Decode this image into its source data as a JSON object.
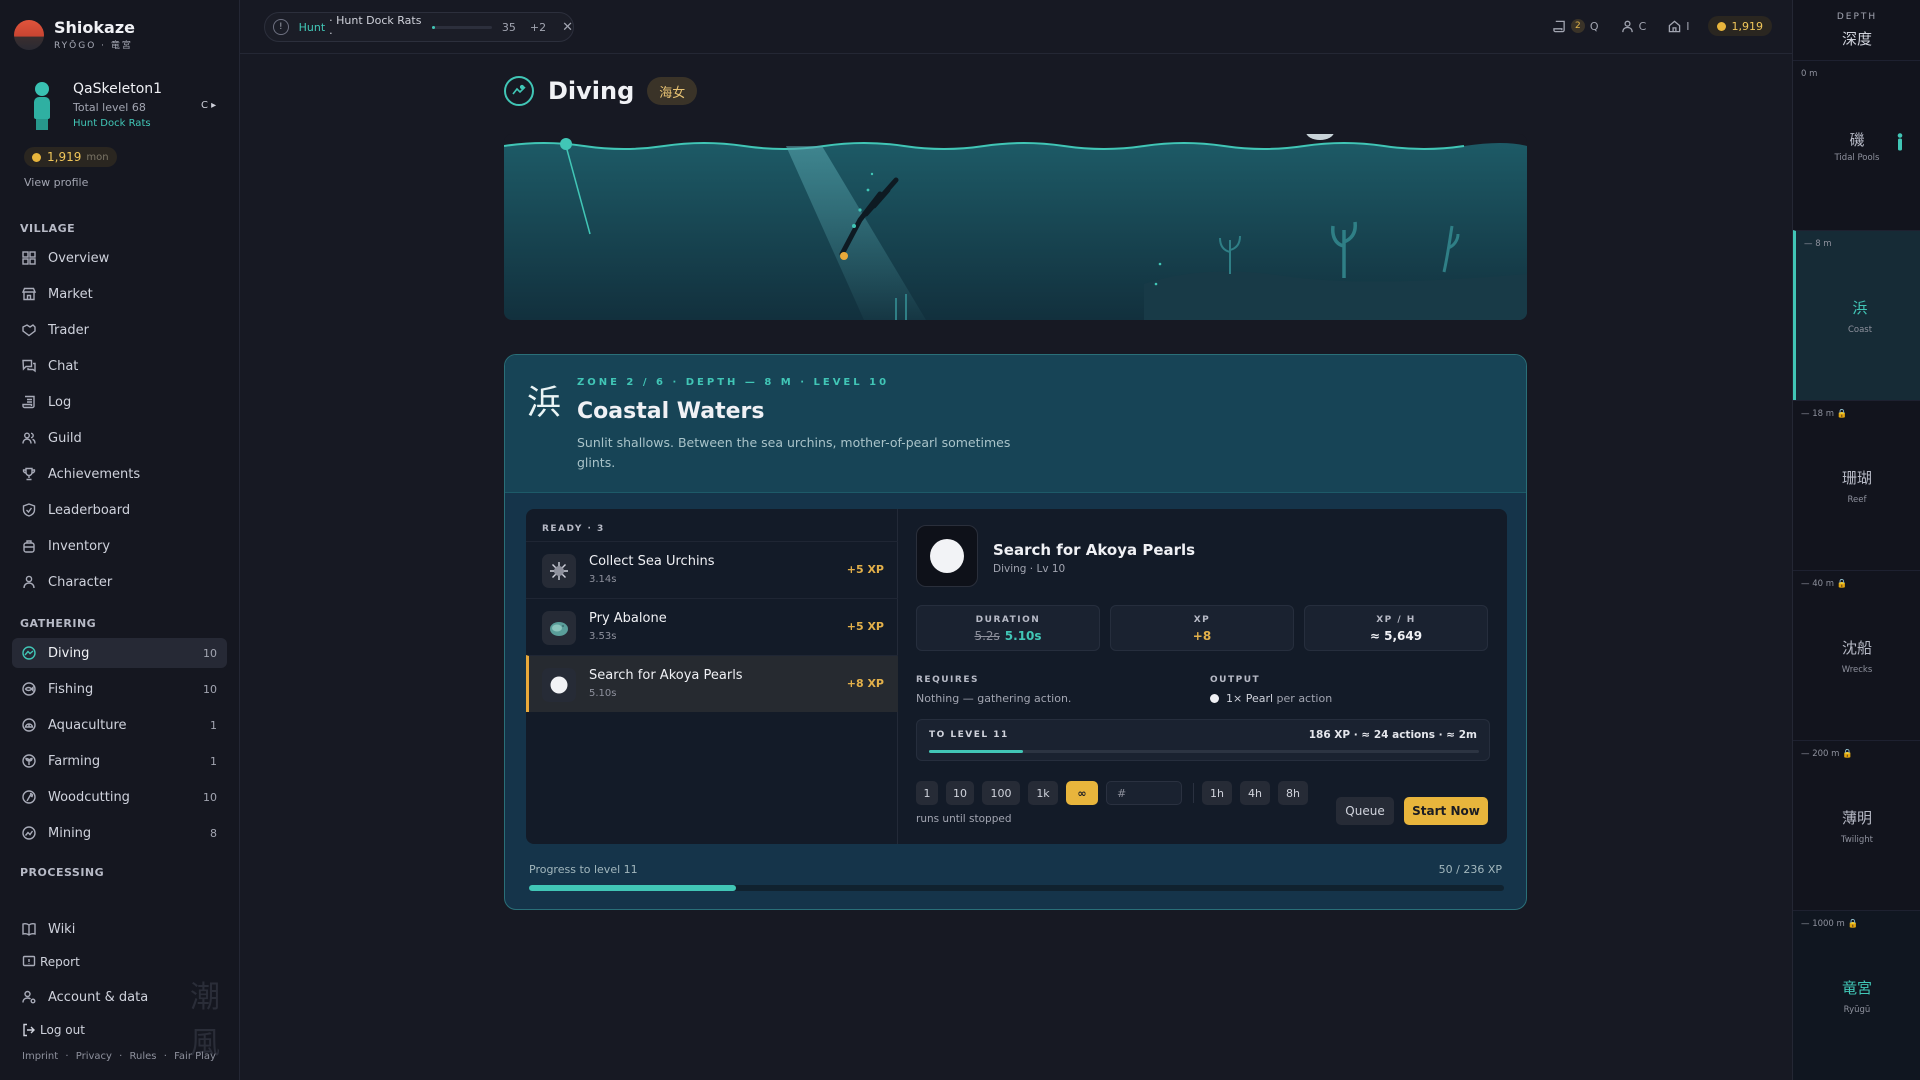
{
  "brand": {
    "name": "Shiokaze",
    "subtitle": "RYŌGO · 竜宮"
  },
  "profile": {
    "name": "QaSkeleton1",
    "level_text": "Total level 68",
    "task": "Hunt Dock Rats",
    "toggle": "C ▸",
    "coins": "1,919",
    "coin_unit": "mon",
    "view_profile": "View profile"
  },
  "sections": {
    "village": "VILLAGE",
    "gathering": "GATHERING",
    "processing": "PROCESSING"
  },
  "village_nav": [
    {
      "label": "Overview",
      "icon": "grid-icon"
    },
    {
      "label": "Market",
      "icon": "shop-icon"
    },
    {
      "label": "Trader",
      "icon": "handshake-icon"
    },
    {
      "label": "Chat",
      "icon": "chat-icon"
    },
    {
      "label": "Log",
      "icon": "scroll-icon"
    },
    {
      "label": "Guild",
      "icon": "users-icon"
    },
    {
      "label": "Achievements",
      "icon": "trophy-icon"
    },
    {
      "label": "Leaderboard",
      "icon": "shield-icon"
    },
    {
      "label": "Inventory",
      "icon": "backpack-icon"
    },
    {
      "label": "Character",
      "icon": "person-icon"
    }
  ],
  "gathering_nav": [
    {
      "label": "Diving",
      "badge": "10",
      "icon": "wave-icon",
      "active": true
    },
    {
      "label": "Fishing",
      "badge": "10",
      "icon": "fish-icon"
    },
    {
      "label": "Aquaculture",
      "badge": "1",
      "icon": "shell-icon"
    },
    {
      "label": "Farming",
      "badge": "1",
      "icon": "sprout-icon"
    },
    {
      "label": "Woodcutting",
      "badge": "10",
      "icon": "axe-icon"
    },
    {
      "label": "Mining",
      "badge": "8",
      "icon": "pickaxe-icon"
    }
  ],
  "bottom_nav": {
    "wiki": "Wiki",
    "report": "Report",
    "account": "Account & data",
    "logout": "Log out"
  },
  "watermark": "潮風",
  "footer": [
    "Imprint",
    "·",
    "Privacy",
    "·",
    "Rules",
    "·",
    "Fair Play"
  ],
  "topbar": {
    "task_kind": "Hunt",
    "task_name": "· Hunt Dock Rats ·",
    "task_progress": 0.05,
    "task_count": "35",
    "task_extra": "+2",
    "close": "✕",
    "mail_count": "2",
    "mail_label": "Q",
    "profile_label": "C",
    "house_label": "I",
    "coins": "1,919"
  },
  "page": {
    "title": "Diving",
    "tag": "海女"
  },
  "zone": {
    "kanji": "浜",
    "meta": "ZONE 2 / 6 · DEPTH — 8 M · LEVEL 10",
    "title": "Coastal Waters",
    "description": "Sunlit shallows. Between the sea urchins, mother-of-pearl sometimes glints."
  },
  "actions": {
    "ready_label": "READY · 3",
    "items": [
      {
        "name": "Collect Sea Urchins",
        "time": "3.14s",
        "xp": "+5 XP",
        "icon": "urchin-icon"
      },
      {
        "name": "Pry Abalone",
        "time": "3.53s",
        "xp": "+5 XP",
        "icon": "abalone-icon"
      },
      {
        "name": "Search for Akoya Pearls",
        "time": "5.10s",
        "xp": "+8 XP",
        "icon": "pearl-icon",
        "selected": true
      }
    ]
  },
  "detail": {
    "name": "Search for Akoya Pearls",
    "sub": "Diving · Lv 10",
    "duration_label": "DURATION",
    "duration_old": "5.2s",
    "duration_new": "5.10s",
    "xp_label": "XP",
    "xp_val": "+8",
    "xph_label": "XP / H",
    "xph_val": "≈ 5,649",
    "requires_label": "REQUIRES",
    "requires_text": "Nothing — gathering action.",
    "output_label": "OUTPUT",
    "output_qty": "1×",
    "output_item": "Pearl",
    "output_suffix": "per action",
    "level_label": "TO LEVEL 11",
    "level_info": "186 XP · ≈ 24 actions · ≈ 2m",
    "level_progress": 0.17,
    "qty_options": [
      "1",
      "10",
      "100",
      "1k",
      "∞"
    ],
    "qty_placeholder": "#",
    "time_options": [
      "1h",
      "4h",
      "8h"
    ],
    "runs_note": "runs until stopped",
    "queue_label": "Queue",
    "start_label": "Start Now"
  },
  "progress": {
    "label": "Progress to level 11",
    "value": "50 / 236 XP",
    "fraction": 0.212
  },
  "depth_rail": {
    "title": "DEPTH",
    "title_jp": "深度",
    "zones": [
      {
        "depth": "0 m",
        "kanji": "磯",
        "name": "Tidal Pools"
      },
      {
        "depth": "— 8 m",
        "kanji": "浜",
        "name": "Coast",
        "active": true
      },
      {
        "depth": "— 18 m 🔒",
        "kanji": "珊瑚",
        "name": "Reef"
      },
      {
        "depth": "— 40 m 🔒",
        "kanji": "沈船",
        "name": "Wrecks"
      },
      {
        "depth": "— 200 m 🔒",
        "kanji": "薄明",
        "name": "Twilight"
      },
      {
        "depth": "— 1000 m 🔒",
        "kanji": "竜宮",
        "name": "Ryūgū"
      }
    ]
  },
  "colors": {
    "accent": "#41c6b6",
    "gold": "#e8b53c",
    "background": "#171923"
  }
}
